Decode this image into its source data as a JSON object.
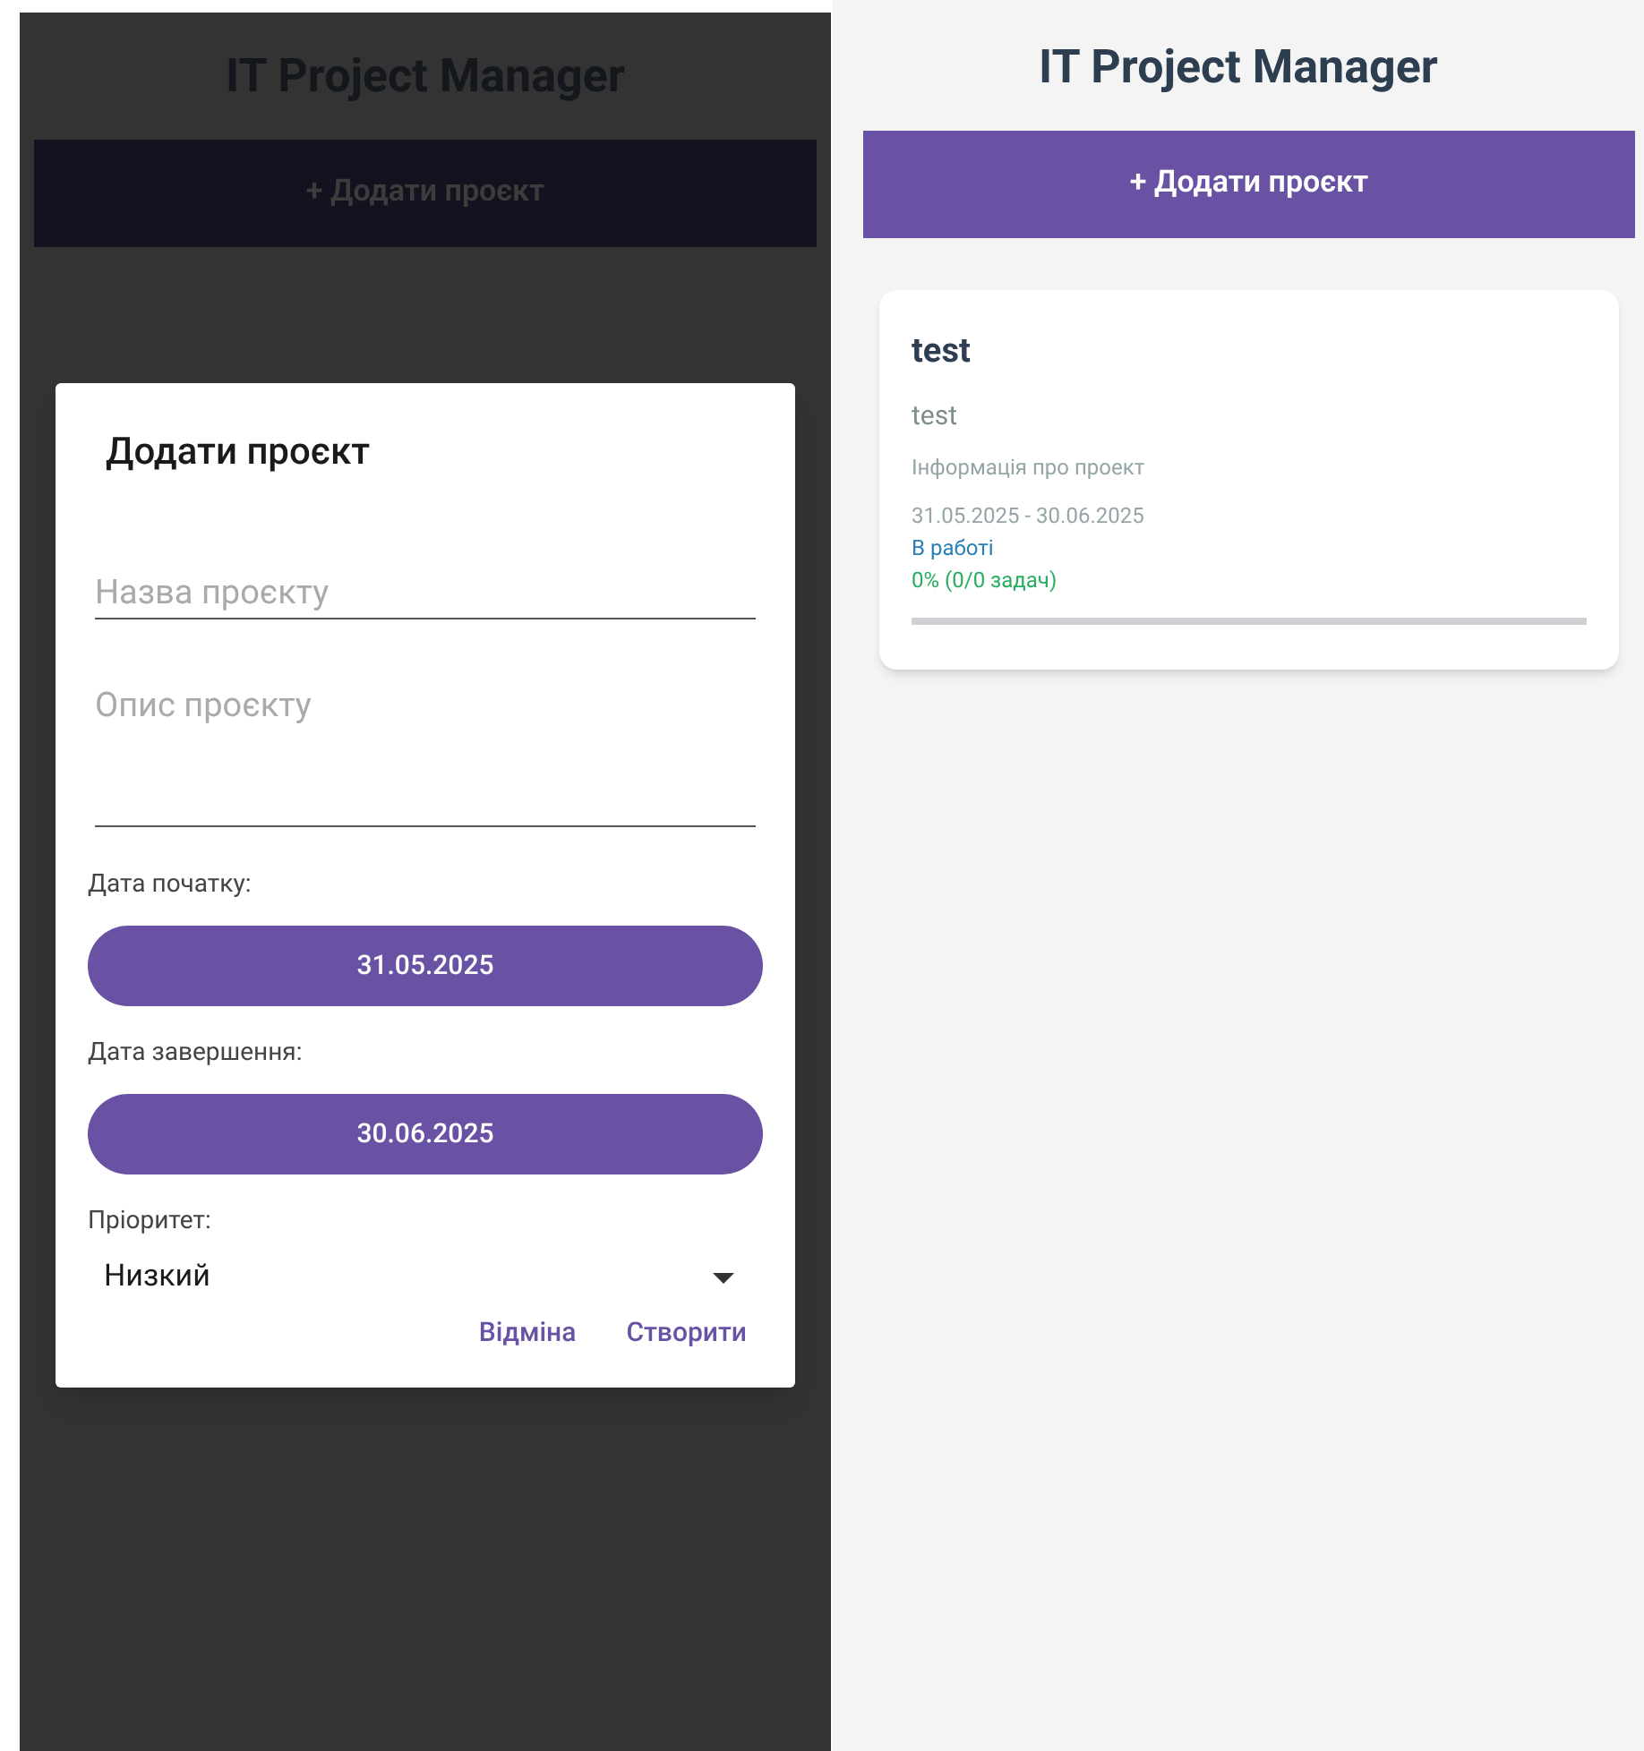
{
  "left_screen": {
    "title": "IT Project Manager",
    "add_button": "+ Додати проєкт",
    "dialog": {
      "title": "Додати проєкт",
      "fields": [
        {
          "kind": "line",
          "placeholder": "Назва проєкту"
        },
        {
          "kind": "multiline",
          "placeholder": "Опис проєкту"
        }
      ],
      "start_date_label": "Дата початку:",
      "start_date": "31.05.2025",
      "end_date_label": "Дата завершення:",
      "end_date": "30.06.2025",
      "priority_label": "Пріоритет:",
      "priority_value": "Низкий",
      "actions": [
        "Відміна",
        "Створити"
      ]
    }
  },
  "right_screen": {
    "title": "IT Project Manager",
    "add_button": "+ Додати проєкт",
    "projects": [
      {
        "name": "test",
        "description": "test",
        "info": "Інформація про проект",
        "dates": "31.05.2025 - 30.06.2025",
        "status": "В работі",
        "progress_text": "0% (0/0 задач)",
        "level": 0
      }
    ]
  }
}
